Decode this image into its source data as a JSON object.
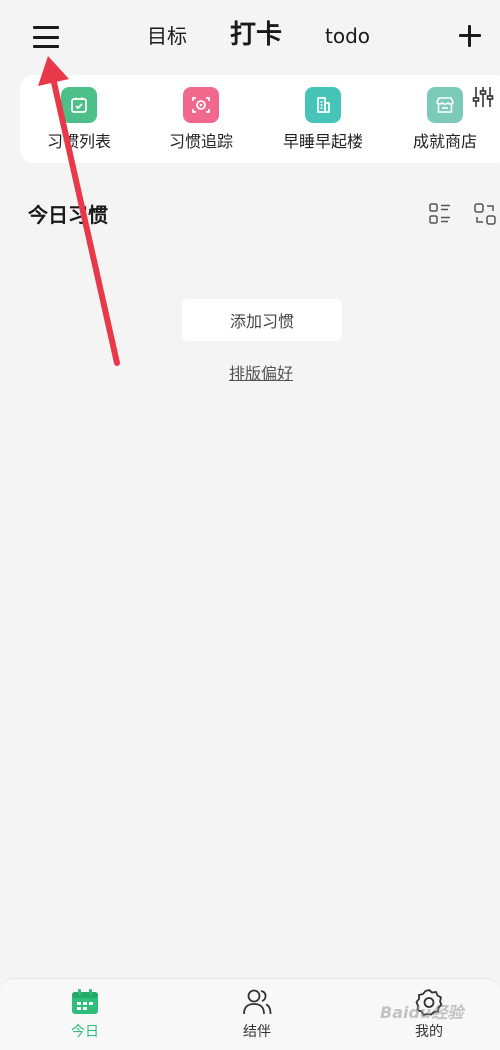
{
  "header": {
    "tabs": {
      "goal": "目标",
      "checkin": "打卡",
      "todo": "todo"
    }
  },
  "shortcuts": [
    {
      "label": "习惯列表",
      "icon": "calendar-check-icon",
      "color": "#4dc08a"
    },
    {
      "label": "习惯追踪",
      "icon": "focus-target-icon",
      "color": "#f0688c"
    },
    {
      "label": "早睡早起楼",
      "icon": "building-icon",
      "color": "#46c4b8"
    },
    {
      "label": "成就商店",
      "icon": "store-icon",
      "color": "#7ccab8"
    }
  ],
  "section": {
    "title": "今日习惯",
    "add_habit": "添加习惯",
    "layout_pref": "排版偏好"
  },
  "bottom_nav": {
    "today": "今日",
    "partner": "结伴",
    "mine": "我的"
  },
  "colors": {
    "accent": "#2dbf7a",
    "background": "#f4f4f4",
    "annotation_arrow": "#e8394a"
  },
  "watermark": "Baidu经验"
}
